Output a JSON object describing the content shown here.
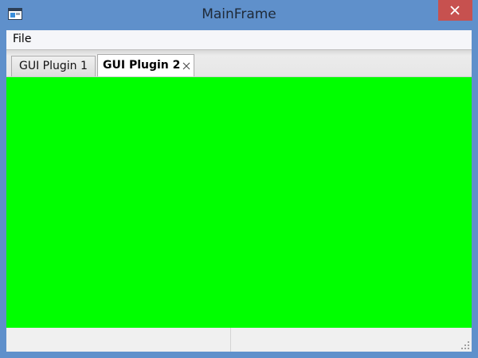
{
  "window": {
    "title": "MainFrame",
    "icon": "app-window-icon",
    "close_icon": "close-icon",
    "close_color": "#c7514f",
    "frame_color": "#5f90cb"
  },
  "menubar": {
    "items": [
      {
        "label": "File"
      }
    ]
  },
  "tabs": [
    {
      "label": "GUI Plugin 1",
      "active": false,
      "closable": false
    },
    {
      "label": "GUI Plugin 2",
      "active": true,
      "closable": true,
      "close_icon": "close-icon"
    }
  ],
  "content": {
    "background_color": "#00ff00"
  },
  "statusbar": {
    "panes": [
      "",
      ""
    ],
    "grip_icon": "size-grip-icon"
  }
}
